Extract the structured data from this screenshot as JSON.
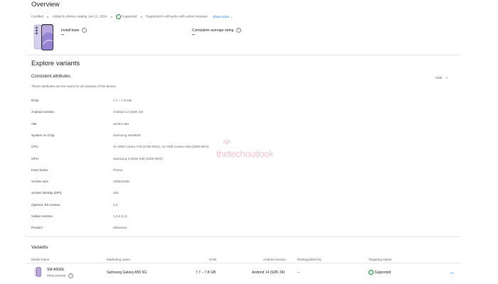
{
  "overview": {
    "title": "Overview",
    "certified": "Certified",
    "added": "Added to device catalog Jan 12, 2024",
    "supported": "Supported",
    "supported_desc": "Supported in all tracks with active releases",
    "show_more": "Show more",
    "install_base_label": "Install base",
    "install_base_value": "–",
    "rating_label": "Cumulative average rating",
    "rating_value": "–"
  },
  "explore": {
    "title": "Explore variants",
    "consistent_title": "Consistent attributes",
    "consistent_desc": "These attributes are the same for all variants of this device.",
    "hide_label": "Hide"
  },
  "attributes": [
    {
      "label": "RAM",
      "value": "7.7 – 7.8 GB"
    },
    {
      "label": "Android version",
      "value": "Android 14 (SDK 34)"
    },
    {
      "label": "ABI",
      "value": "arm64-v8a"
    },
    {
      "label": "System on Chip",
      "value": "Samsung s5e8845"
    },
    {
      "label": "CPU",
      "value": "4x ARM Cortex-A78 (2750 MHz), 4x ARM Cortex-A55 (2000 MHz)"
    },
    {
      "label": "GPU",
      "value": "Samsung Xclipse 530 (1300 MHz)"
    },
    {
      "label": "Form factor",
      "value": "Phone"
    },
    {
      "label": "Screen size",
      "value": "1080x2340"
    },
    {
      "label": "Screen density (DPI)",
      "value": "450"
    },
    {
      "label": "OpenGL ES version",
      "value": "3.2"
    },
    {
      "label": "Vulkan version",
      "value": "1.3.0 (L1)"
    },
    {
      "label": "Product",
      "value": "a55xnsxx"
    }
  ],
  "watermark": "thetechoutlook",
  "variants": {
    "title": "Variants",
    "headers": {
      "model": "Model name",
      "marketing": "Marketing name",
      "ram": "RAM",
      "android": "Android version",
      "distinguished": "Distinguished by",
      "status": "Targeting status"
    },
    "row": {
      "model": "SM-A556E",
      "badge": "Most popular",
      "marketing": "Samsung Galaxy A55 5G",
      "ram": "7.7 – 7.8 GB",
      "android": "Android 14 (SDK 34)",
      "distinguished": "–",
      "status": "Supported"
    }
  },
  "colors": {
    "accent": "#1a73e8",
    "success": "#188038",
    "phone_lavender": "#b9a7e0"
  }
}
